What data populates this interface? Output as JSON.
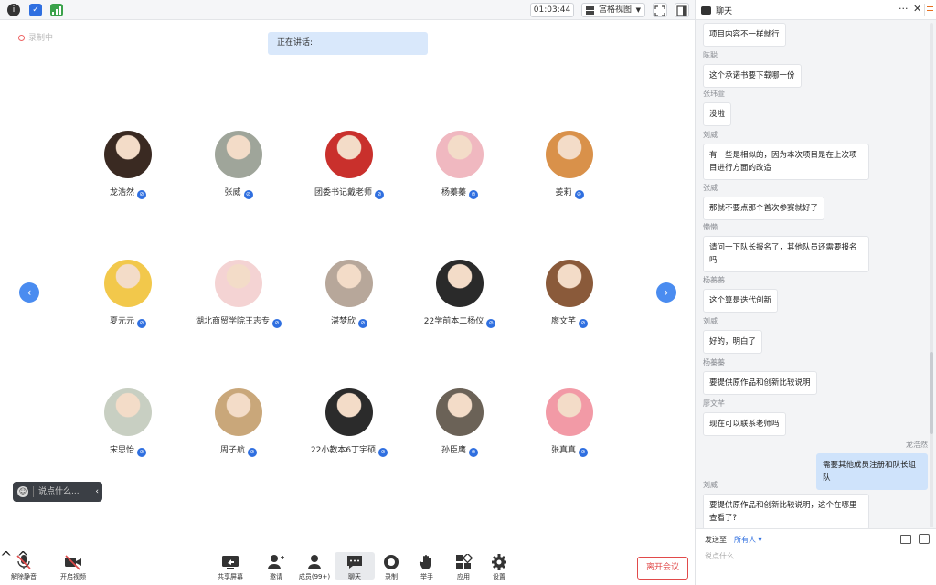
{
  "topbar": {
    "info_icon": "info-icon",
    "shield_icon": "shield-icon",
    "signal_icon": "signal-icon",
    "timer": "01:03:44",
    "view_mode": "宫格视图",
    "fullscreen_icon": "fullscreen-icon",
    "layout_icon": "layout-icon"
  },
  "recording": {
    "label": "录制中"
  },
  "speaking": {
    "label": "正在讲话:"
  },
  "participants": [
    {
      "name": "龙浩然",
      "color": "#3a2a22"
    },
    {
      "name": "张威",
      "color": "#9fa59a"
    },
    {
      "name": "团委书记戴老师",
      "color": "#c9302c"
    },
    {
      "name": "杨蓁蓁",
      "color": "#f0b8c0"
    },
    {
      "name": "姜莉",
      "color": "#d9914a"
    },
    {
      "name": "夏元元",
      "color": "#f2c84b"
    },
    {
      "name": "湖北商贸学院王志专",
      "color": "#f4d3d3"
    },
    {
      "name": "湛梦欣",
      "color": "#b7a79a"
    },
    {
      "name": "22学前本二杨仪",
      "color": "#2a2a2a"
    },
    {
      "name": "廖文芊",
      "color": "#8a5a3a"
    },
    {
      "name": "宋思怡",
      "color": "#c8cfc2"
    },
    {
      "name": "周子航",
      "color": "#c9a77a"
    },
    {
      "name": "22小教本6丁宇硕",
      "color": "#2b2b2b"
    },
    {
      "name": "孙臣鹰",
      "color": "#6b6257"
    },
    {
      "name": "张真真",
      "color": "#f29aa6"
    }
  ],
  "nav": {
    "prev": "‹",
    "next": "›"
  },
  "quick_chat": {
    "placeholder": "说点什么...",
    "arrow": "‹"
  },
  "toolbar": {
    "unmute": "解除静音",
    "start_video": "开启视频",
    "share_screen": "共享屏幕",
    "invite": "邀请",
    "members": "成员(99+)",
    "chat": "聊天",
    "record": "录制",
    "raise_hand": "举手",
    "apps": "应用",
    "settings": "设置",
    "leave": "离开会议"
  },
  "chat": {
    "title": "聊天",
    "more": "···",
    "close": "✕",
    "messages": [
      {
        "sender": "",
        "text": "项目内容不一样就行",
        "me": false
      },
      {
        "sender": "陈聪",
        "text": "这个承诺书要下载哪一份",
        "me": false
      },
      {
        "sender": "张玮萱",
        "text": "没啦",
        "me": false
      },
      {
        "sender": "刘威",
        "text": "有一些是相似的，因为本次项目是在上次项目进行方面的改造",
        "me": false
      },
      {
        "sender": "张威",
        "text": "那就不要点那个首次参赛就好了",
        "me": false
      },
      {
        "sender": "懒懒",
        "text": "请问一下队长报名了，其他队员还需要报名吗",
        "me": false
      },
      {
        "sender": "杨蓁蓁",
        "text": "这个算是迭代创新",
        "me": false
      },
      {
        "sender": "刘威",
        "text": "好的，明白了",
        "me": false
      },
      {
        "sender": "杨蓁蓁",
        "text": "要提供原作品和创新比较说明",
        "me": false
      },
      {
        "sender": "廖文芊",
        "text": "现在可以联系老师吗",
        "me": false
      },
      {
        "sender": "龙浩然",
        "text": "需要其他成员注册和队长组队",
        "me": true
      },
      {
        "sender": "刘威",
        "text": "要提供原作品和创新比较说明，这个在哪里查看了?",
        "me": false
      }
    ],
    "send_to_label": "发送至",
    "send_to_value": "所有人 ▾",
    "input_placeholder": "说点什么..."
  }
}
